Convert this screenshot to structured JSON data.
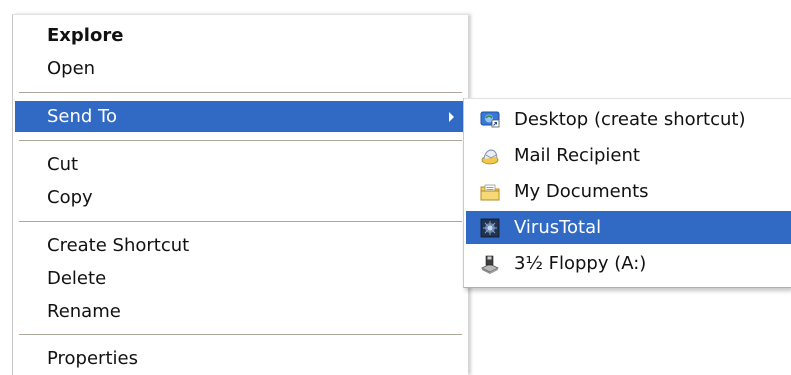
{
  "context_menu": {
    "items": [
      {
        "label": "Explore"
      },
      {
        "label": "Open"
      },
      {
        "label": "Send To"
      },
      {
        "label": "Cut"
      },
      {
        "label": "Copy"
      },
      {
        "label": "Create Shortcut"
      },
      {
        "label": "Delete"
      },
      {
        "label": "Rename"
      },
      {
        "label": "Properties"
      }
    ]
  },
  "send_to_menu": {
    "items": [
      {
        "label": "Desktop (create shortcut)",
        "icon": "desktop-icon"
      },
      {
        "label": "Mail Recipient",
        "icon": "mail-icon"
      },
      {
        "label": "My Documents",
        "icon": "folder-icon"
      },
      {
        "label": "VirusTotal",
        "icon": "virustotal-icon"
      },
      {
        "label": "3½ Floppy (A:)",
        "icon": "floppy-drive-icon"
      }
    ]
  },
  "colors": {
    "highlight": "#316ac5",
    "separator": "#aca899"
  }
}
